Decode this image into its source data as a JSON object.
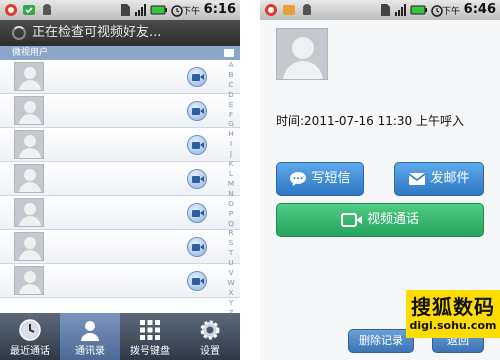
{
  "left": {
    "status": {
      "time": "6:16",
      "label": "下午"
    },
    "search": {
      "text": "正在检查可视频好友..."
    },
    "section": {
      "title": "微视用户"
    },
    "alphabet": [
      "A",
      "B",
      "C",
      "D",
      "E",
      "F",
      "G",
      "H",
      "I",
      "J",
      "K",
      "L",
      "M",
      "N",
      "O",
      "P",
      "Q",
      "R",
      "S",
      "T",
      "U",
      "V",
      "W",
      "X",
      "Y",
      "Z",
      "#"
    ],
    "tabs": [
      {
        "label": "最近通话",
        "icon": "clock-icon"
      },
      {
        "label": "通讯录",
        "icon": "contacts-icon"
      },
      {
        "label": "拨号键盘",
        "icon": "dialpad-icon"
      },
      {
        "label": "设置",
        "icon": "gear-icon"
      }
    ]
  },
  "right": {
    "status": {
      "time": "6:46",
      "label": "下午"
    },
    "call_time": "时间:2011-07-16 11:30 上午呼入",
    "buttons": {
      "sms": "写短信",
      "email": "发邮件",
      "video": "视频通话",
      "delete": "删除记录",
      "back": "返回"
    }
  },
  "watermark": {
    "title": "搜狐数码",
    "url": "digi.sohu.com"
  },
  "colors": {
    "accent_blue": "#2f78c4",
    "green": "#24a45c",
    "tab_active": "#4d6a96",
    "watermark": "#ffdd00"
  }
}
